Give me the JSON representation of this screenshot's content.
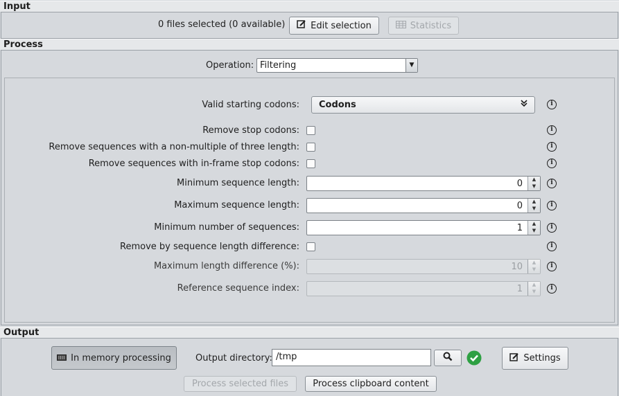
{
  "input": {
    "header": "Input",
    "files_status": "0 files selected (0 available)",
    "edit_selection_label": "Edit selection",
    "statistics_label": "Statistics"
  },
  "process": {
    "header": "Process",
    "operation_label": "Operation:",
    "operation_value": "Filtering",
    "valid_codons_label": "Valid starting codons:",
    "valid_codons_value": "Codons",
    "remove_stop_codons_label": "Remove stop codons:",
    "remove_non_multiple_label": "Remove sequences with a non-multiple of three length:",
    "remove_inframe_label": "Remove sequences with in-frame stop codons:",
    "min_length_label": "Minimum sequence length:",
    "min_length_value": "0",
    "max_length_label": "Maximum sequence length:",
    "max_length_value": "0",
    "min_sequences_label": "Minimum number of sequences:",
    "min_sequences_value": "1",
    "remove_by_diff_label": "Remove by sequence length difference:",
    "max_diff_label": "Maximum length difference (%):",
    "max_diff_value": "10",
    "ref_index_label": "Reference sequence index:",
    "ref_index_value": "1"
  },
  "output": {
    "header": "Output",
    "in_memory_label": "In memory processing",
    "output_dir_label": "Output directory:",
    "output_dir_value": "/tmp",
    "settings_label": "Settings",
    "process_selected_label": "Process selected files",
    "process_clipboard_label": "Process clipboard content"
  },
  "icons": {
    "info": "info-icon",
    "edit": "edit-icon",
    "table": "table-icon",
    "search": "search-icon",
    "check": "check-icon",
    "memory": "memory-icon",
    "dropdown": "chevron-down-icon"
  },
  "colors": {
    "check_green": "#2ea043",
    "background": "#d6d9dd"
  }
}
